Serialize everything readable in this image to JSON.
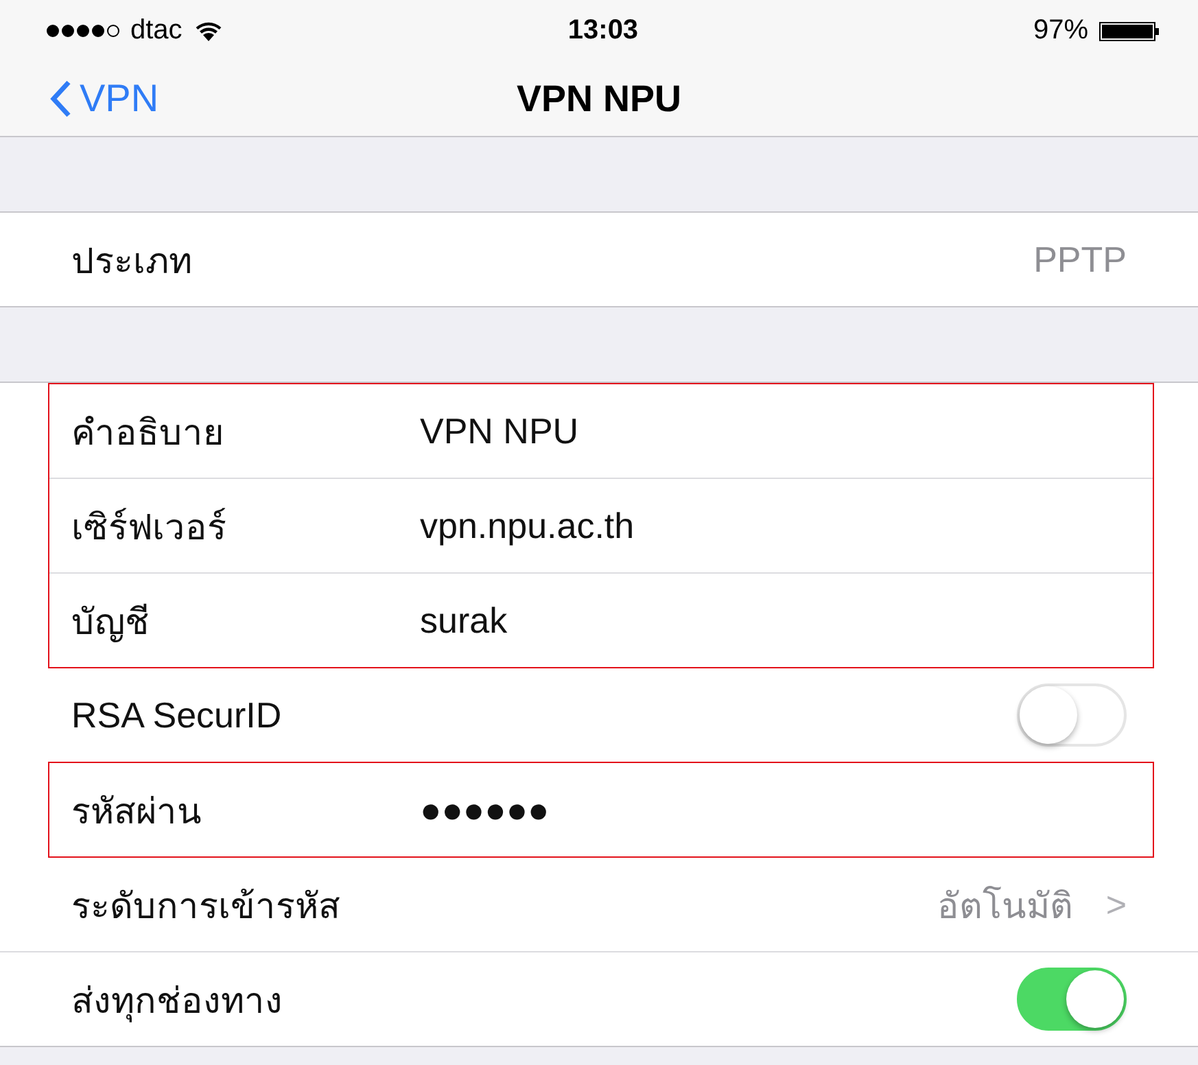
{
  "status_bar": {
    "signal": [
      {
        "filled": true
      },
      {
        "filled": true
      },
      {
        "filled": true
      },
      {
        "filled": true
      },
      {
        "filled": false
      }
    ],
    "carrier": "dtac",
    "time": "13:03",
    "battery": "97%"
  },
  "nav": {
    "back": "VPN",
    "title": "VPN NPU"
  },
  "sections": [
    {
      "rows": [
        {
          "kind": "value",
          "label": "ประเภท",
          "value": "PPTP",
          "highlighted": false
        }
      ]
    },
    {
      "rows": [
        {
          "kind": "field",
          "label": "คำอธิบาย",
          "value": "VPN NPU",
          "highlighted": true
        },
        {
          "kind": "field",
          "label": "เซิร์ฟเวอร์",
          "value": "vpn.npu.ac.th",
          "highlighted": true
        },
        {
          "kind": "field",
          "label": "บัญชี",
          "value": "surak",
          "highlighted": true
        },
        {
          "kind": "switch",
          "label": "RSA SecurID",
          "on": false,
          "highlighted": false
        },
        {
          "kind": "field",
          "label": "รหัสผ่าน",
          "value": "●●●●●●",
          "highlighted": true
        },
        {
          "kind": "disclosure",
          "label": "ระดับการเข้ารหัส",
          "value": "อัตโนมัติ",
          "chevron": ">",
          "highlighted": false
        },
        {
          "kind": "switch",
          "label": "ส่งทุกช่องทาง",
          "on": true,
          "highlighted": false
        }
      ]
    }
  ]
}
